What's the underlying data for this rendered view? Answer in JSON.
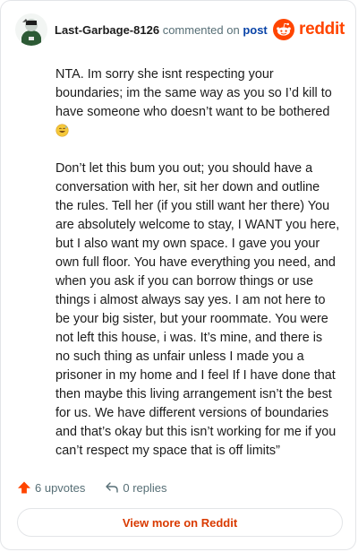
{
  "header": {
    "username": "Last-Garbage-8126",
    "action_text": "commented on",
    "post_link": "post",
    "brand": "reddit"
  },
  "comment": {
    "paragraph1": "NTA. Im sorry she isnt respecting your boundaries; im the same way as you so I’d kill to have someone who doesn’t want to be bothered",
    "paragraph1_emoji": "grinning-sweat-emoji",
    "paragraph2": "Don’t let this bum you out; you should have a conversation with her, sit her down and outline the rules. Tell her (if you still want her there) You are absolutely welcome to stay, I WANT you here, but I also want my own space. I gave you your own full floor. You have everything you need, and when you ask if you can borrow things or use things i almost always say yes. I am not here to be your big sister, but your roommate. You were not left this house, i was. It’s mine, and there is no such thing as unfair unless I made you a prisoner in my home and I feel If I have done that then maybe this living arrangement isn’t the best for us. We have different versions of boundaries and that’s okay but this isn’t working for me if you can’t respect my space that is off limits”"
  },
  "footer": {
    "upvotes": "6 upvotes",
    "replies": "0 replies",
    "view_more": "View more on Reddit"
  },
  "colors": {
    "brand": "#ff4500",
    "post_link": "#0a44a8",
    "view_more": "#d93a00",
    "muted": "#576f76"
  },
  "icons": {
    "avatar": "avatar",
    "logo": "reddit-logo-icon",
    "upvote": "upvote-arrow-icon",
    "reply": "reply-arrow-icon"
  }
}
